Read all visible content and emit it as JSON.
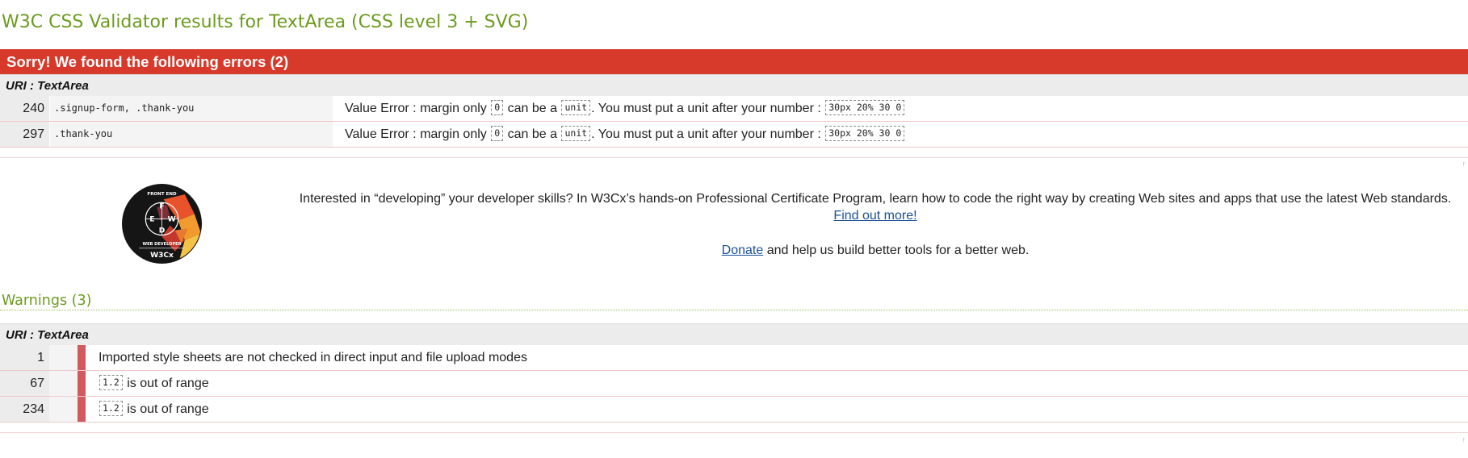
{
  "page": {
    "title": "W3C CSS Validator results for TextArea (CSS level 3 + SVG)"
  },
  "errors": {
    "header": "Sorry! We found the following errors (2)",
    "uri_label": "URI : TextArea",
    "rows": [
      {
        "line": "240",
        "context": ".signup-form, .thank-you",
        "msg_prefix": "Value Error : margin only",
        "code_zero": "0",
        "msg_mid": "can be a",
        "code_unit": "unit",
        "msg_suffix": ". You must put a unit after your number :",
        "code_value": "30px 20% 30 0"
      },
      {
        "line": "297",
        "context": ".thank-you",
        "msg_prefix": "Value Error : margin only",
        "code_zero": "0",
        "msg_mid": "can be a",
        "code_unit": "unit",
        "msg_suffix": ". You must put a unit after your number :",
        "code_value": "30px 20% 30 0"
      }
    ]
  },
  "promo": {
    "text": "Interested in “developing” your developer skills? In W3Cx’s hands-on Professional Certificate Program, learn how to code the right way by creating Web sites and apps that use the latest Web standards.",
    "link": "Find out more!",
    "donate_link": "Donate",
    "donate_text": " and help us build better tools for a better web.",
    "logo_text": {
      "ring_top": "FRONT END",
      "ring_bottom": "WEB DEVELOPER",
      "letters": [
        "F",
        "E",
        "W",
        "D"
      ],
      "brand": "W3Cx"
    }
  },
  "warnings": {
    "title": "Warnings (3)",
    "uri_label": "URI : TextArea",
    "rows": [
      {
        "line": "1",
        "code": "",
        "text": "Imported style sheets are not checked in direct input and file upload modes"
      },
      {
        "line": "67",
        "code": "1.2",
        "text": " is out of range"
      },
      {
        "line": "234",
        "code": "1.2",
        "text": " is out of range"
      }
    ]
  },
  "icons": {
    "scroll_top": "arrow-up-icon",
    "logo": "w3cx-fewd-logo"
  },
  "colors": {
    "title_green": "#6b9b1e",
    "error_red": "#d7392a",
    "warning_bar": "#d05a5e",
    "link_blue": "#1a4f97"
  }
}
